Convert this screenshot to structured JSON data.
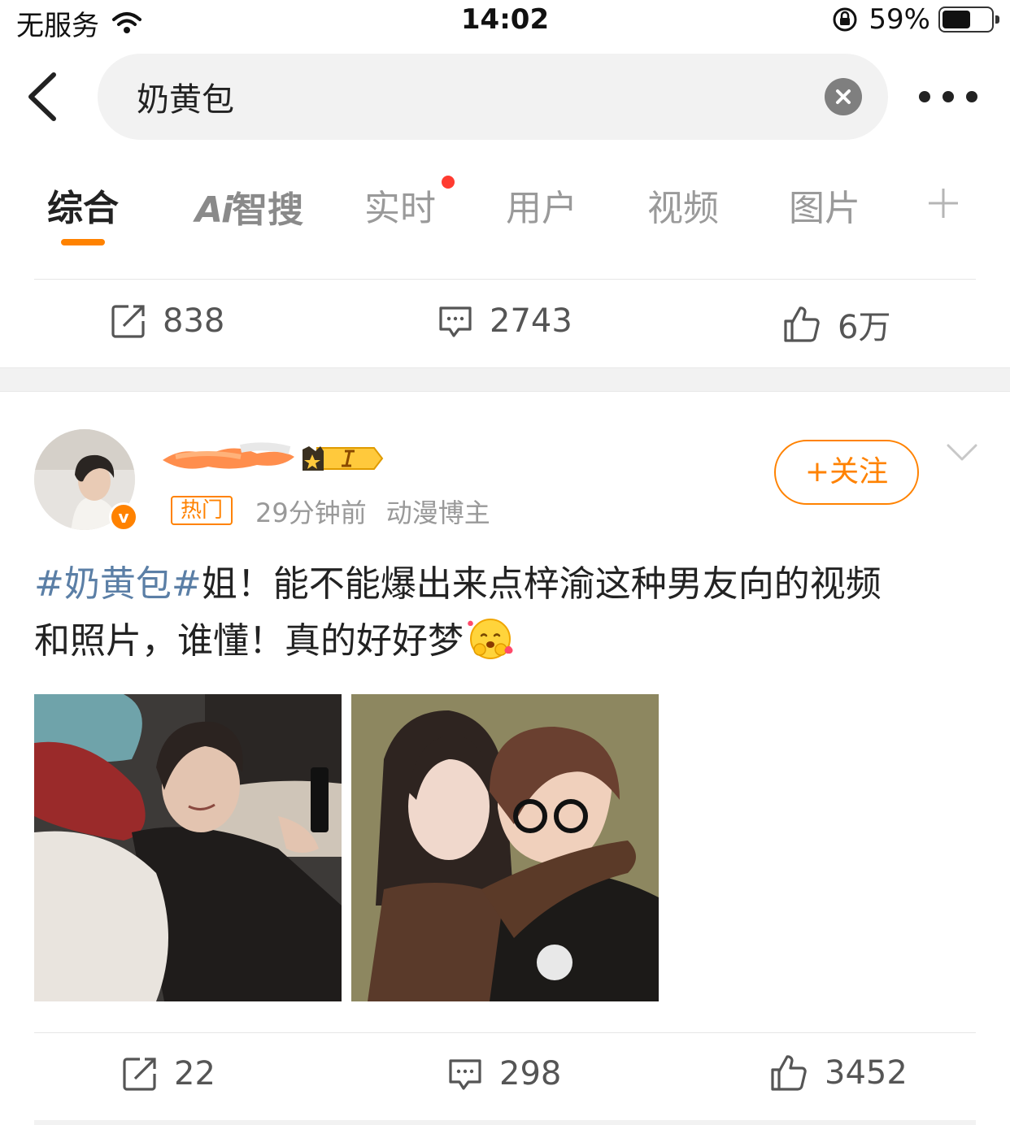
{
  "status_bar": {
    "carrier": "无服务",
    "time": "14:02",
    "battery": "59%",
    "battery_level": 0.59
  },
  "search": {
    "query": "奶黄包"
  },
  "tabs": [
    {
      "label": "综合",
      "active": true
    },
    {
      "label": "Ai智搜",
      "brand": "Ai",
      "rest": "智搜"
    },
    {
      "label": "实时",
      "has_dot": true
    },
    {
      "label": "用户"
    },
    {
      "label": "视频"
    },
    {
      "label": "图片"
    }
  ],
  "prev_post": {
    "reposts": "838",
    "comments": "2743",
    "likes": "6万"
  },
  "post": {
    "hot_tag": "热门",
    "time": "29分钟前",
    "role": "动漫博主",
    "follow_label": "+关注",
    "verified_mark": "v",
    "topic": "#奶黄包#",
    "text_line1": "姐！能不能爆出来点梓渝这种男友向的视频",
    "text_line2": "和照片，谁懂！真的好好梦",
    "emoji": "hugging-face-emoji",
    "images": [
      "photo-guy-lying-with-phone",
      "photo-couple-selfie"
    ],
    "reposts": "22",
    "comments": "298",
    "likes": "3452"
  },
  "colors": {
    "accent": "#ff8200",
    "topic": "#5b7fa6",
    "red_dot": "#ff3b30"
  }
}
